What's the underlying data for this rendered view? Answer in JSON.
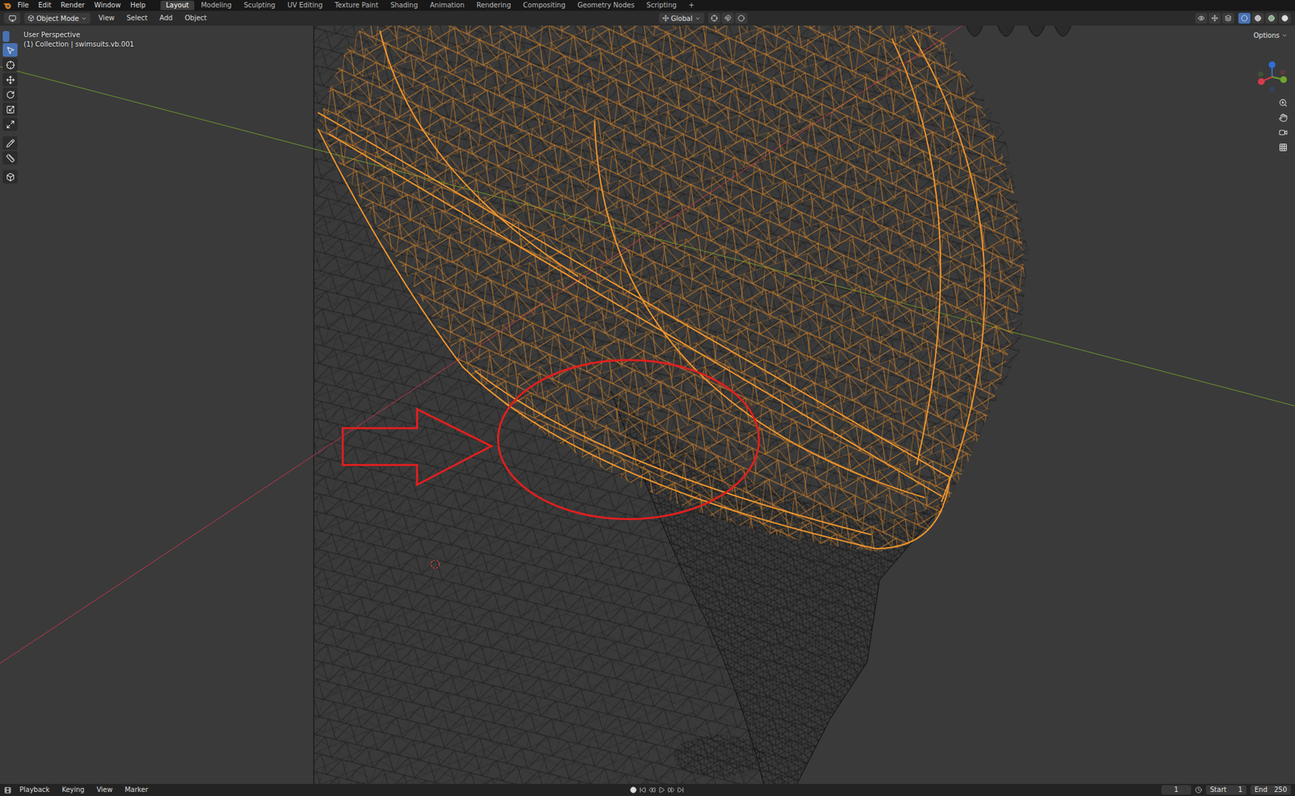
{
  "menu": [
    "File",
    "Edit",
    "Render",
    "Window",
    "Help"
  ],
  "workspaces": [
    {
      "label": "Layout",
      "selected": true
    },
    {
      "label": "Modeling",
      "selected": false
    },
    {
      "label": "Sculpting",
      "selected": false
    },
    {
      "label": "UV Editing",
      "selected": false
    },
    {
      "label": "Texture Paint",
      "selected": false
    },
    {
      "label": "Shading",
      "selected": false
    },
    {
      "label": "Animation",
      "selected": false
    },
    {
      "label": "Rendering",
      "selected": false
    },
    {
      "label": "Compositing",
      "selected": false
    },
    {
      "label": "Geometry Nodes",
      "selected": false
    },
    {
      "label": "Scripting",
      "selected": false
    }
  ],
  "add_workspace": "+",
  "header": {
    "mode": "Object Mode",
    "menus": [
      "View",
      "Select",
      "Add",
      "Object"
    ],
    "orientation": "Global",
    "options": "Options",
    "select_modes": [
      {
        "selected": true
      },
      {
        "selected": false
      },
      {
        "selected": false
      },
      {
        "selected": false
      }
    ],
    "shading_modes": [
      {
        "selected": true
      },
      {
        "selected": false
      },
      {
        "selected": false
      },
      {
        "selected": false
      }
    ]
  },
  "toolbar": [
    {
      "selected": true
    },
    {
      "selected": false
    },
    {
      "selected": false
    },
    {
      "selected": false
    },
    {
      "selected": false
    },
    {
      "selected": false
    },
    {
      "selected": false
    },
    {
      "selected": false
    },
    {
      "selected": false
    }
  ],
  "viewport": {
    "view": "User Perspective",
    "object": "(1) Collection | swimsuits.vb.001"
  },
  "timeline": {
    "menus": [
      "Playback",
      "Keying",
      "View",
      "Marker"
    ],
    "current_frame": "1",
    "start_label": "Start",
    "start": "1",
    "end_label": "End",
    "end": "250"
  }
}
